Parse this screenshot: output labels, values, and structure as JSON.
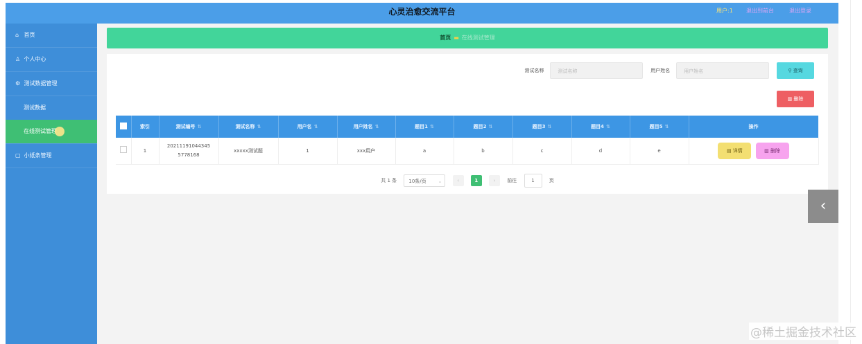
{
  "header": {
    "title": "心灵治愈交流平台",
    "user_label": "用户:1",
    "link_1": "退出到前台",
    "link_2": "退出登录"
  },
  "sidebar": {
    "items": [
      {
        "icon": "⌂",
        "label": "首页"
      },
      {
        "icon": "♙",
        "label": "个人中心"
      },
      {
        "icon": "⚙",
        "label": "测试数据管理"
      }
    ],
    "sub_items": [
      {
        "label": "测试数据"
      },
      {
        "label": "在线测试管理"
      }
    ],
    "last_item": {
      "icon": "▢",
      "label": "小纸条管理"
    }
  },
  "breadcrumb": {
    "home": "首页",
    "current": "在线测试管理"
  },
  "search": {
    "label_1": "测试名称",
    "placeholder_1": "测试名称",
    "label_2": "用户姓名",
    "placeholder_2": "用户姓名",
    "search_button": "查询",
    "delete_button": "删除"
  },
  "table": {
    "columns": [
      "索引",
      "测试编号",
      "测试名称",
      "用户名",
      "用户姓名",
      "题目1",
      "题目2",
      "题目3",
      "题目4",
      "题目5",
      "操作"
    ],
    "rows": [
      {
        "index": "1",
        "test_no": "20211191044345 5778168",
        "test_name": "xxxxx测试题",
        "username": "1",
        "realname": "xxx用户",
        "q1": "a",
        "q2": "b",
        "q3": "c",
        "q4": "d",
        "q5": "e",
        "detail_label": "详情",
        "delete_label": "删除"
      }
    ]
  },
  "pagination": {
    "total": "共 1 条",
    "page_size": "10条/页",
    "prev": "‹",
    "current_page": "1",
    "next": "›",
    "goto_label": "前往",
    "goto_value": "1",
    "page_suffix": "页"
  },
  "side_arrow": "‹",
  "watermark": "@稀土掘金技术社区",
  "colors": {
    "header": "#4b9ee8",
    "sidebar": "#3e8ed9",
    "breadcrumb": "#42d59a",
    "table_header": "#3d96e4",
    "active_menu": "#3fbf74",
    "search_button": "#56d8e0",
    "delete_button": "#ee5f63"
  }
}
